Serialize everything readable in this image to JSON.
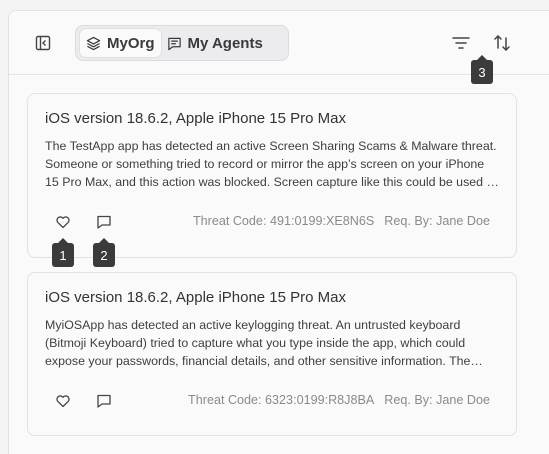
{
  "header": {
    "tabs": [
      {
        "label": "MyOrg",
        "icon": "layers-icon",
        "active": true
      },
      {
        "label": "My Agents",
        "icon": "message-square-text-icon",
        "active": false
      }
    ],
    "sidebar_toggle_icon": "panel-left-icon",
    "filter_icon": "filter-lines-icon",
    "sort_icon": "sort-arrows-icon"
  },
  "badges": {
    "b1": "1",
    "b2": "2",
    "b3": "3"
  },
  "cards": [
    {
      "title": "iOS version 18.6.2, Apple iPhone 15 Pro Max",
      "description": "The TestApp app has detected an active Screen Sharing Scams & Malware threat. Someone or something tried to record or mirror the app’s screen on your iPhone 15 Pro Max, and this action was blocked. Screen capture like this could be used to steal sensitive information.",
      "threat_code": "Threat Code: 491:0199:XE8N6S",
      "requested_by": "Req. By: Jane Doe"
    },
    {
      "title": "iOS version 18.6.2, Apple iPhone 15 Pro Max",
      "description": "MyiOSApp has detected an active keylogging threat. An untrusted keyboard (Bitmoji Keyboard) tried to capture what you type inside the app, which could expose your passwords, financial details, and other sensitive information. The keyboard was blocked.",
      "threat_code": "Threat Code: 6323:0199:R8J8BA",
      "requested_by": "Req. By: Jane Doe"
    }
  ],
  "colors": {
    "badge": "#3b3b3b",
    "muted_text": "#8a8a8e",
    "background": "#fafafa"
  }
}
